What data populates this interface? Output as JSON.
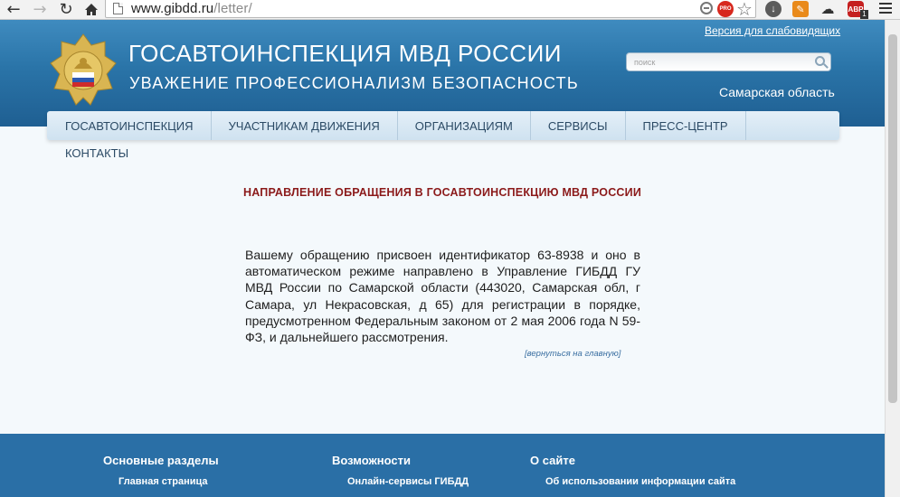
{
  "browser": {
    "url_host": "www.gibdd.ru",
    "url_path": "/letter/",
    "pro_badge": "PRO",
    "abp_label": "ABP",
    "abp_count": "1"
  },
  "header": {
    "title": "ГОСАВТОИНСПЕКЦИЯ МВД РОССИИ",
    "slogan": "УВАЖЕНИЕ  ПРОФЕССИОНАЛИЗМ  БЕЗОПАСНОСТЬ",
    "low_vision_link": "Версия для слабовидящих",
    "search_placeholder": "поиск",
    "region": "Самарская область"
  },
  "menu": {
    "items": [
      "ГОСАВТОИНСПЕКЦИЯ",
      "УЧАСТНИКАМ ДВИЖЕНИЯ",
      "ОРГАНИЗАЦИЯМ",
      "СЕРВИСЫ",
      "ПРЕСС-ЦЕНТР",
      "КОНТАКТЫ"
    ]
  },
  "main": {
    "heading": "НАПРАВЛЕНИЕ ОБРАЩЕНИЯ В ГОСАВТОИНСПЕКЦИЮ МВД РОССИИ",
    "notice": "Вашему обращению присвоен идентификатор 63-8938 и оно в автоматическом режиме направлено в Управление ГИБДД ГУ МВД России по Самарской области (443020, Самарская обл, г Самара, ул Некрасовская, д 65) для регистрации в порядке, предусмотренном Федеральным законом от 2 мая 2006 года N 59-ФЗ, и дальнейшего рассмотрения.",
    "back_link": "[вернуться на главную]"
  },
  "footer": {
    "columns": [
      {
        "title": "Основные разделы",
        "first_link": "Главная страница"
      },
      {
        "title": "Возможности",
        "first_link": "Онлайн-сервисы ГИБДД"
      },
      {
        "title": "О сайте",
        "first_link": "Об использовании информации сайта"
      }
    ]
  },
  "colors": {
    "header_blue": "#2a74a8",
    "heading_red": "#8b1a1a",
    "footer_blue": "#2a6fa6",
    "menu_text": "#2b4a65"
  }
}
